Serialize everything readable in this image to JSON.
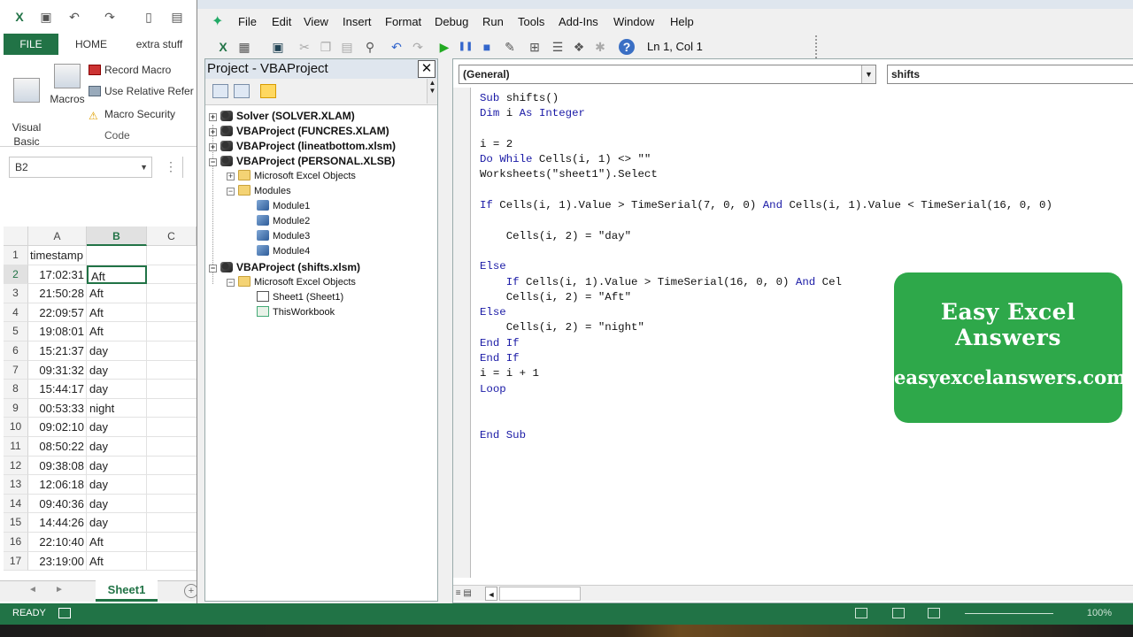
{
  "excel": {
    "tabs": [
      "FILE",
      "HOME",
      "extra stuff"
    ],
    "ribbon": {
      "visual_basic": "Visual\nBasic",
      "macros": "Macros",
      "record_macro": "Record Macro",
      "use_relative": "Use Relative Refer",
      "macro_security": "Macro Security",
      "group_label": "Code"
    },
    "name_box": "B2",
    "columns": [
      "A",
      "B",
      "C"
    ],
    "header_row": {
      "num": "1",
      "a": "timestamp"
    },
    "rows": [
      {
        "num": "2",
        "a": "17:02:31",
        "b": "Aft"
      },
      {
        "num": "3",
        "a": "21:50:28",
        "b": "Aft"
      },
      {
        "num": "4",
        "a": "22:09:57",
        "b": "Aft"
      },
      {
        "num": "5",
        "a": "19:08:01",
        "b": "Aft"
      },
      {
        "num": "6",
        "a": "15:21:37",
        "b": "day"
      },
      {
        "num": "7",
        "a": "09:31:32",
        "b": "day"
      },
      {
        "num": "8",
        "a": "15:44:17",
        "b": "day"
      },
      {
        "num": "9",
        "a": "00:53:33",
        "b": "night"
      },
      {
        "num": "10",
        "a": "09:02:10",
        "b": "day"
      },
      {
        "num": "11",
        "a": "08:50:22",
        "b": "day"
      },
      {
        "num": "12",
        "a": "09:38:08",
        "b": "day"
      },
      {
        "num": "13",
        "a": "12:06:18",
        "b": "day"
      },
      {
        "num": "14",
        "a": "09:40:36",
        "b": "day"
      },
      {
        "num": "15",
        "a": "14:44:26",
        "b": "day"
      },
      {
        "num": "16",
        "a": "22:10:40",
        "b": "Aft"
      },
      {
        "num": "17",
        "a": "23:19:00",
        "b": "Aft"
      }
    ],
    "sheet_tab": "Sheet1",
    "status": "READY",
    "zoom": "100%"
  },
  "vbe": {
    "menu": [
      "File",
      "Edit",
      "View",
      "Insert",
      "Format",
      "Debug",
      "Run",
      "Tools",
      "Add-Ins",
      "Window",
      "Help"
    ],
    "cursor_pos": "Ln 1, Col 1",
    "project_title": "Project - VBAProject",
    "tree": {
      "solver": "Solver (SOLVER.XLAM)",
      "funcres": "VBAProject (FUNCRES.XLAM)",
      "lineat": "VBAProject (lineatbottom.xlsm)",
      "personal": "VBAProject (PERSONAL.XLSB)",
      "meo1": "Microsoft Excel Objects",
      "modules": "Modules",
      "module1": "Module1",
      "module2": "Module2",
      "module3": "Module3",
      "module4": "Module4",
      "shifts": "VBAProject (shifts.xlsm)",
      "meo2": "Microsoft Excel Objects",
      "sheet1": "Sheet1 (Sheet1)",
      "thisworkbook": "ThisWorkbook"
    },
    "object_combo": "(General)",
    "proc_combo": "shifts",
    "code_lines": [
      "Sub shifts()",
      "Dim i As Integer",
      "",
      "i = 2",
      "Do While Cells(i, 1) <> \"\"",
      "Worksheets(\"sheet1\").Select",
      "",
      "If Cells(i, 1).Value > TimeSerial(7, 0, 0) And Cells(i, 1).Value < TimeSerial(16, 0, 0)",
      "",
      "    Cells(i, 2) = \"day\"",
      "",
      "Else",
      "    If Cells(i, 1).Value > TimeSerial(16, 0, 0) And Cel",
      "    Cells(i, 2) = \"Aft\"",
      "Else",
      "    Cells(i, 2) = \"night\"",
      "End If",
      "End If",
      "i = i + 1",
      "Loop",
      "",
      "",
      "End Sub"
    ]
  },
  "banner": {
    "title": "Easy Excel Answers",
    "url": "easyexcelanswers.com",
    "color": "#2ea84a"
  }
}
